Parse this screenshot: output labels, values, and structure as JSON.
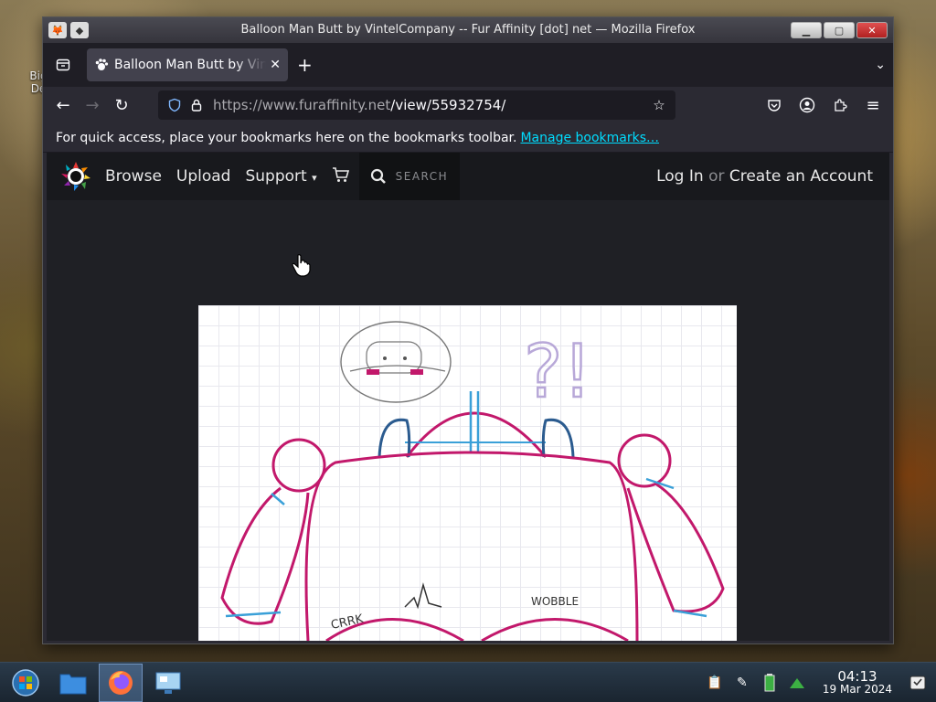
{
  "desktop": {
    "icon_label_1": "Big",
    "icon_label_2": "De"
  },
  "window": {
    "title": "Balloon Man Butt by VintelCompany -- Fur Affinity [dot] net — Mozilla Firefox"
  },
  "tab": {
    "title": "Balloon Man Butt by VintelCompany"
  },
  "navbar": {
    "url_host": "https://www.furaffinity.net",
    "url_path": "/view/55932754/"
  },
  "bookmarks": {
    "message": "For quick access, place your bookmarks here on the bookmarks toolbar.",
    "manage_link": "Manage bookmarks…"
  },
  "site": {
    "nav": {
      "browse": "Browse",
      "upload": "Upload",
      "support": "Support",
      "search_label": "SEARCH",
      "login": "Log In",
      "or": "or",
      "create_account": "Create an Account"
    },
    "artwork": {
      "labels": [
        "CRRK",
        "WOBBLE"
      ],
      "speech_glyphs": "?!"
    }
  },
  "taskbar": {
    "time": "04:13",
    "date": "19 Mar 2024"
  },
  "colors": {
    "firefox_dark": "#2b2a33",
    "link_cyan": "#00ddff",
    "fa_nav_bg": "#18191d",
    "art_outline": "#c2186b",
    "art_blue": "#3aa0d8",
    "art_purple": "#b8a8d8"
  }
}
